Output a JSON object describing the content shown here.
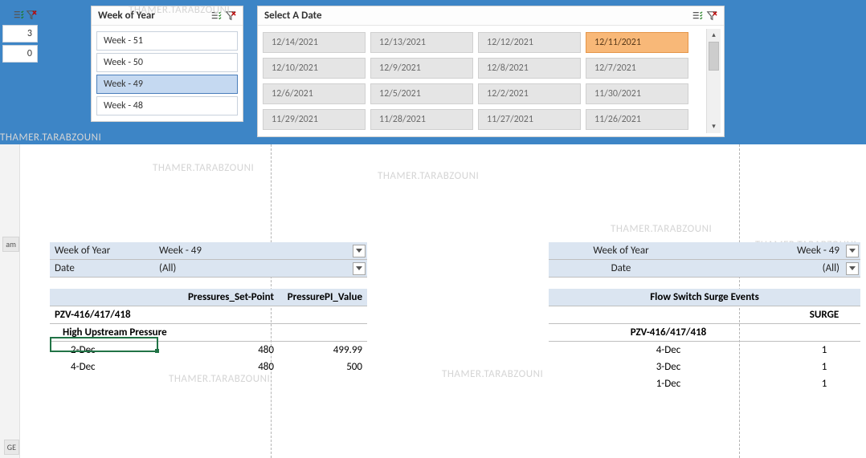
{
  "watermark": "THAMER.TARABZOUNI",
  "frag_items": [
    "3",
    "0"
  ],
  "gutter": {
    "s1": "am",
    "s2": "GE"
  },
  "slicers": {
    "week": {
      "title": "Week of Year",
      "items": [
        {
          "label": "Week - 51",
          "selected": false
        },
        {
          "label": "Week - 50",
          "selected": false
        },
        {
          "label": "Week - 49",
          "selected": true
        },
        {
          "label": "Week - 48",
          "selected": false
        }
      ]
    },
    "date": {
      "title": "Select A Date",
      "items": [
        {
          "label": "12/14/2021",
          "selected": false
        },
        {
          "label": "12/13/2021",
          "selected": false
        },
        {
          "label": "12/12/2021",
          "selected": false
        },
        {
          "label": "12/11/2021",
          "selected": true
        },
        {
          "label": "12/10/2021",
          "selected": false
        },
        {
          "label": "12/9/2021",
          "selected": false
        },
        {
          "label": "12/8/2021",
          "selected": false
        },
        {
          "label": "12/7/2021",
          "selected": false
        },
        {
          "label": "12/6/2021",
          "selected": false
        },
        {
          "label": "12/5/2021",
          "selected": false
        },
        {
          "label": "12/2/2021",
          "selected": false
        },
        {
          "label": "11/30/2021",
          "selected": false
        },
        {
          "label": "11/29/2021",
          "selected": false
        },
        {
          "label": "11/28/2021",
          "selected": false
        },
        {
          "label": "11/27/2021",
          "selected": false
        },
        {
          "label": "11/26/2021",
          "selected": false
        }
      ]
    }
  },
  "pivot_left": {
    "filters": [
      {
        "label": "Week of Year",
        "value": "Week - 49"
      },
      {
        "label": "Date",
        "value": "(All)"
      }
    ],
    "headers": {
      "c2": "Pressures_Set-Point",
      "c3": "PressurePI_Value"
    },
    "category": "PZV-416/417/418",
    "subcategory": "High Upstream Pressure",
    "rows": [
      {
        "date": "2-Dec",
        "setpoint": "480",
        "value": "499.99"
      },
      {
        "date": "4-Dec",
        "setpoint": "480",
        "value": "500"
      }
    ]
  },
  "pivot_right": {
    "filters": [
      {
        "label": "Week of Year",
        "value": "Week - 49"
      },
      {
        "label": "Date",
        "value": "(All)"
      }
    ],
    "header": "Flow Switch Surge Events",
    "col2": "SURGE",
    "category": "PZV-416/417/418",
    "rows": [
      {
        "date": "4-Dec",
        "surge": "1"
      },
      {
        "date": "3-Dec",
        "surge": "1"
      },
      {
        "date": "1-Dec",
        "surge": "1"
      }
    ]
  }
}
